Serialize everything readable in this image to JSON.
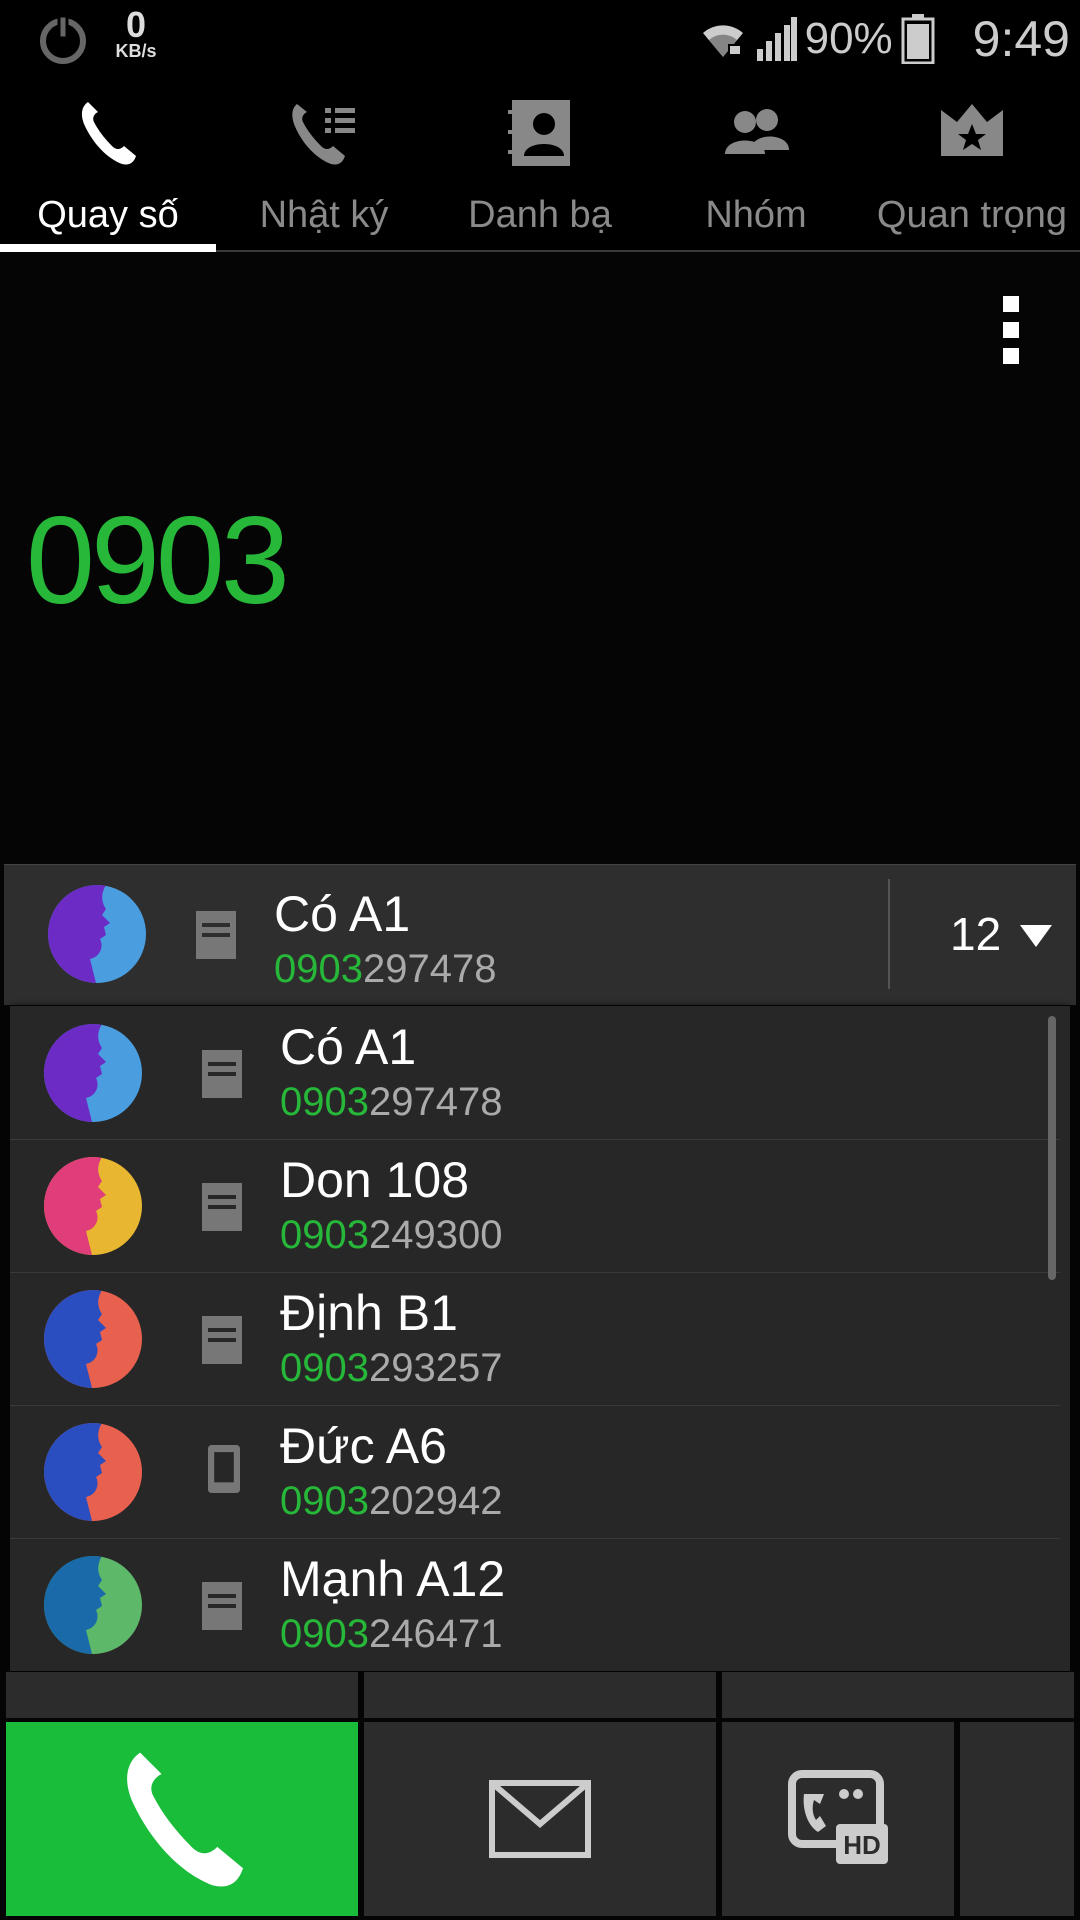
{
  "status_bar": {
    "net_speed_value": "0",
    "net_speed_unit": "KB/s",
    "battery_percent": "90%",
    "time": "9:49",
    "icons": [
      "power-icon",
      "wifi-icon",
      "signal-icon",
      "battery-icon"
    ]
  },
  "tabs": [
    {
      "label": "Quay số",
      "icon": "phone-icon",
      "active": true
    },
    {
      "label": "Nhật ký",
      "icon": "call-log-icon",
      "active": false
    },
    {
      "label": "Danh bạ",
      "icon": "contacts-book-icon",
      "active": false
    },
    {
      "label": "Nhóm",
      "icon": "group-icon",
      "active": false
    },
    {
      "label": "Quan trọng",
      "icon": "crown-star-icon",
      "active": false
    }
  ],
  "dialer": {
    "entered_number": "0903"
  },
  "selected_contact": {
    "name": "Có A1",
    "number_match": "0903",
    "number_rest": "297478",
    "match_count": "12"
  },
  "suggestions": [
    {
      "name": "Có A1",
      "number_match": "0903",
      "number_rest": "297478",
      "type_icon": "sim-icon"
    },
    {
      "name": "Don 108",
      "number_match": "0903",
      "number_rest": "249300",
      "type_icon": "sim-icon"
    },
    {
      "name": "Định B1",
      "number_match": "0903",
      "number_rest": "293257",
      "type_icon": "sim-icon"
    },
    {
      "name": "Đức A6",
      "number_match": "0903",
      "number_rest": "202942",
      "type_icon": "phone-device-icon"
    },
    {
      "name": "Mạnh A12",
      "number_match": "0903",
      "number_rest": "246471",
      "type_icon": "sim-icon"
    }
  ],
  "actions": {
    "call_icon": "phone-icon",
    "message_icon": "envelope-icon",
    "video_icon": "hd-video-call-icon"
  },
  "colors": {
    "accent_green": "#27b739",
    "call_button": "#1abd3a",
    "panel": "#2e2e2e",
    "list": "#272727"
  }
}
